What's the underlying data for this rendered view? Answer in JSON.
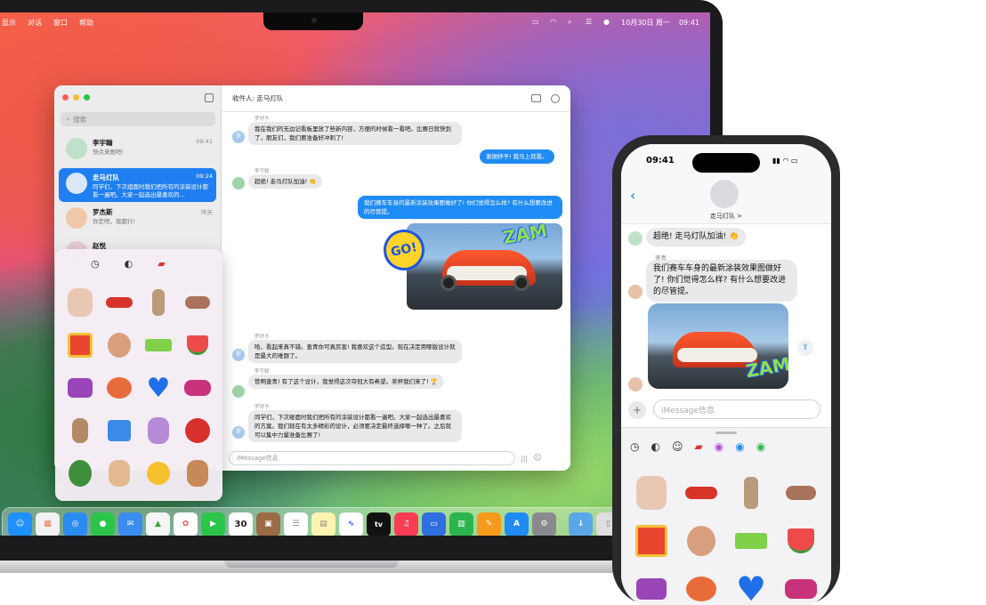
{
  "menubar": {
    "menus": [
      "显示",
      "对话",
      "窗口",
      "帮助"
    ],
    "date": "10月30日 周一",
    "time": "09:41"
  },
  "sidebar": {
    "search_placeholder": "搜索",
    "conversations": [
      {
        "name": "李宇翰",
        "time": "09:41",
        "preview": "快点来图吧!"
      },
      {
        "name": "走马灯队",
        "time": "09:24",
        "preview": "同学们，下次组面时我们把所有的涂装设计都看一遍吧。大家一起选出最喜欢的..."
      },
      {
        "name": "罗杰斯",
        "time": "昨天",
        "preview": "你定吧，我都行!"
      },
      {
        "name": "赵悦",
        "time": "",
        "preview": ""
      }
    ]
  },
  "chat": {
    "recipient": "收件人: 走马灯队",
    "messages": [
      {
        "sender": "罗妤予",
        "text": "我在我们的无边记看板里放了些新内容，方便的时候看一看吧。比赛日就快到了，朋友们，我们要准备好冲刺了!",
        "from_me": false
      },
      {
        "sender": "",
        "text": "谢谢妤予! 我马上就看。",
        "from_me": true
      },
      {
        "sender": "李宇翰",
        "text": "超绝! 走马灯队加油! 👏",
        "from_me": false
      },
      {
        "sender": "",
        "text": "我们赛车车身的最新涂装效果图做好了! 你们觉得怎么样? 有什么想要改进的尽管提。",
        "from_me": true
      },
      {
        "sender": "罗妤予",
        "text": "哈，看起来真不错。查青你可真厉害! 我喜欢这个造型。现在决定用哪版设计就是最大的难题了。",
        "from_me": false
      },
      {
        "sender": "李宇翰",
        "text": "赞啊查青! 有了这个设计，我觉得这次夺冠大有希望。奖杯我们来了! 🏆",
        "from_me": false
      },
      {
        "sender": "罗妤予",
        "text": "同学们，下次碰面时我们把所有的涂装设计都看一遍吧。大家一起选出最喜欢的方案。我们现在有太多精彩的设计，必须要决定最终选择哪一种了。之后就可以集中力量准备比赛了!",
        "from_me": false
      }
    ],
    "sticker_text_go": "GO!",
    "sticker_text_zam": "ZAM",
    "input_placeholder": "iMessage信息"
  },
  "iphone": {
    "time": "09:41",
    "group_name": "走马灯队 >",
    "messages": [
      {
        "sender": "",
        "text": "超绝! 走马灯队加油! 👏"
      },
      {
        "sender": "查青",
        "text": "我们赛车车身的最新涂装效果图做好了! 你们觉得怎么样? 有什么想要改进的尽管提。"
      }
    ],
    "input_placeholder": "iMessage信息"
  },
  "dock": {
    "calendar_day": "30",
    "tv_label": "tv"
  }
}
